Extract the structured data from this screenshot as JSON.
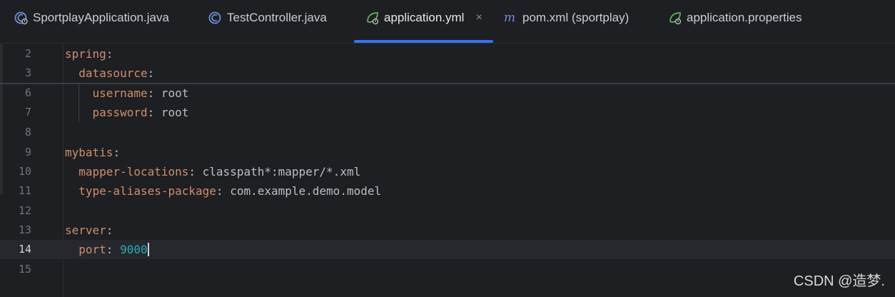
{
  "tabs": [
    {
      "label": "SportplayApplication.java",
      "icon": "spring-java-class-icon",
      "active": false
    },
    {
      "label": "TestController.java",
      "icon": "java-class-icon",
      "active": false
    },
    {
      "label": "application.yml",
      "icon": "spring-config-icon",
      "active": true,
      "close": "×"
    },
    {
      "label": "pom.xml (sportplay)",
      "icon": "maven-icon",
      "active": false
    },
    {
      "label": "application.properties",
      "icon": "spring-config-icon",
      "active": false
    }
  ],
  "editor": {
    "lines": [
      {
        "num": "2",
        "indent": "",
        "key": "spring",
        "sep": ":",
        "value": ""
      },
      {
        "num": "3",
        "indent": "  ",
        "key": "datasource",
        "sep": ":",
        "value": ""
      },
      {
        "num": "6",
        "indent": "    ",
        "key": "username",
        "sep": ": ",
        "value": "root"
      },
      {
        "num": "7",
        "indent": "    ",
        "key": "password",
        "sep": ": ",
        "value": "root"
      },
      {
        "num": "8",
        "indent": "",
        "key": "",
        "sep": "",
        "value": ""
      },
      {
        "num": "9",
        "indent": "",
        "key": "mybatis",
        "sep": ":",
        "value": ""
      },
      {
        "num": "10",
        "indent": "  ",
        "key": "mapper-locations",
        "sep": ": ",
        "value": "classpath*:mapper/*.xml"
      },
      {
        "num": "11",
        "indent": "  ",
        "key": "type-aliases-package",
        "sep": ": ",
        "value": "com.example.demo.model"
      },
      {
        "num": "12",
        "indent": "",
        "key": "",
        "sep": "",
        "value": ""
      },
      {
        "num": "13",
        "indent": "",
        "key": "server",
        "sep": ":",
        "value": ""
      },
      {
        "num": "14",
        "indent": "  ",
        "key": "port",
        "sep": ": ",
        "value": "9000",
        "numeric": true,
        "current": true
      },
      {
        "num": "15",
        "indent": "",
        "key": "",
        "sep": "",
        "value": ""
      }
    ]
  },
  "watermark": "CSDN @造梦."
}
